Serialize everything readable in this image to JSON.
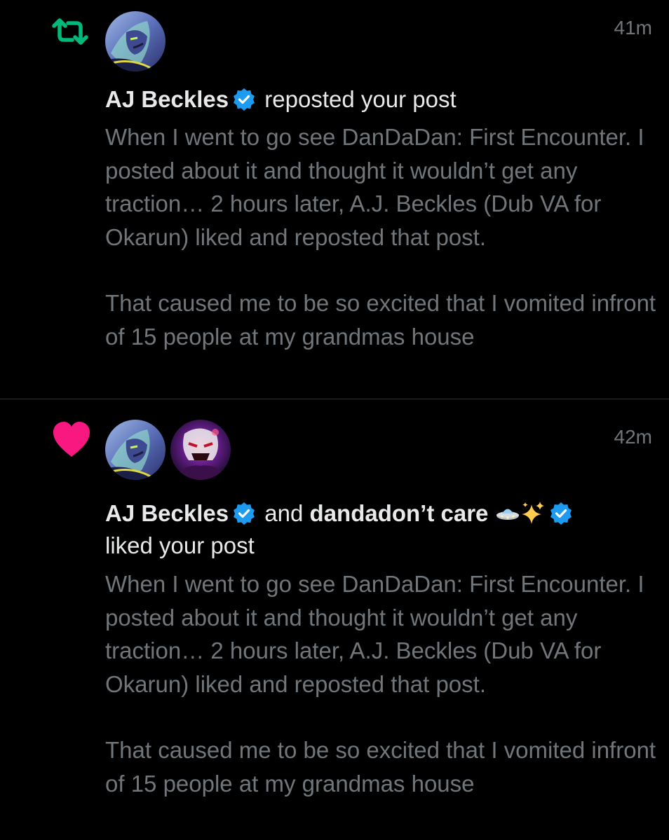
{
  "notifications": [
    {
      "type_icon": "repost-icon",
      "type_color": "#00ba7c",
      "timestamp": "41m",
      "actors": [
        {
          "name": "AJ Beckles",
          "verified": true
        }
      ],
      "action": "reposted your post",
      "post_text": [
        "When I went to go see DanDaDan: First Encounter. I posted about it and thought it wouldn’t get any traction… 2 hours later, A.J. Beckles (Dub VA for Okarun) liked and reposted that post.",
        "That caused me to be so excited that I vomited infront of 15 people at my grandmas house"
      ]
    },
    {
      "type_icon": "heart-icon",
      "type_color": "#f91880",
      "timestamp": "42m",
      "actors": [
        {
          "name": "AJ Beckles",
          "verified": true
        },
        {
          "name": "dandadon’t care",
          "verified": true,
          "emojis": [
            "ufo-emoji",
            "sparkles-emoji"
          ]
        }
      ],
      "connector": "and",
      "action": "liked your post",
      "post_text": [
        "When I went to go see DanDaDan: First Encounter. I posted about it and thought it wouldn’t get any traction… 2 hours later, A.J. Beckles (Dub VA for Okarun) liked and reposted that post.",
        "That caused me to be so excited that I vomited infront of 15 people at my grandmas house"
      ]
    }
  ],
  "colors": {
    "background": "#000000",
    "primary_text": "#e7e9ea",
    "secondary_text": "#71767b",
    "verified_blue": "#1d9bf0",
    "divider": "#2f3336"
  }
}
